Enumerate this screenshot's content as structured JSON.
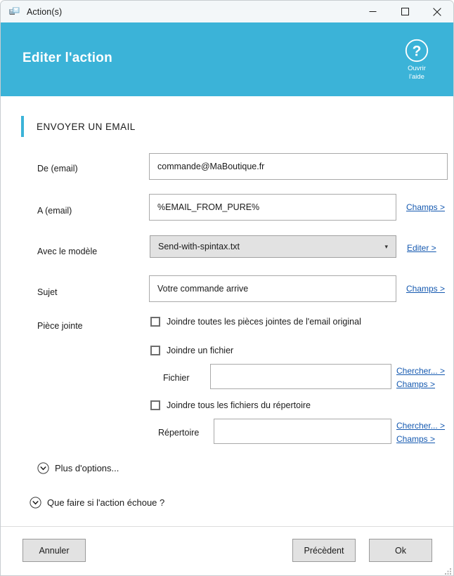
{
  "window": {
    "title": "Action(s)",
    "icon": "mail-action-icon",
    "controls": {
      "minimize": "minimize-icon",
      "maximize": "maximize-icon",
      "close": "close-icon"
    }
  },
  "header": {
    "title": "Editer l'action",
    "accent_color": "#3bb3d8",
    "help": {
      "icon": "question-mark-circle-icon",
      "line1": "Ouvrir",
      "line2": "l'aide"
    }
  },
  "section": {
    "title": "ENVOYER UN EMAIL"
  },
  "fields": {
    "from": {
      "label": "De (email)",
      "value": "commande@MaBoutique.fr",
      "placeholder": ""
    },
    "to": {
      "label": "A (email)",
      "value": "%EMAIL_FROM_PURE%",
      "placeholder": "",
      "link": "Champs >"
    },
    "template": {
      "label": "Avec le modèle",
      "value": "Send-with-spintax.txt",
      "caret": "chevron-down-icon",
      "link": "Editer >"
    },
    "subject": {
      "label": "Sujet",
      "value": "Votre commande arrive",
      "placeholder": "",
      "link": "Champs >"
    }
  },
  "attachment": {
    "label": "Pièce jointe",
    "check_all_original": {
      "label": "Joindre toutes les pièces jointes de l'email original",
      "checked": false
    },
    "check_file": {
      "label": "Joindre un fichier",
      "checked": false
    },
    "file": {
      "label": "Fichier",
      "value": "",
      "placeholder": "",
      "link_browse": "Chercher... >",
      "link_fields": "Champs >"
    },
    "check_directory": {
      "label": "Joindre tous les fichiers du répertoire",
      "checked": false
    },
    "directory": {
      "label": "Répertoire",
      "value": "",
      "placeholder": "",
      "link_browse": "Chercher... >",
      "link_fields": "Champs >"
    }
  },
  "expanders": {
    "more_options": {
      "label": "Plus d'options...",
      "icon": "chevron-down-circle-icon"
    },
    "on_failure": {
      "label": "Que faire si l'action échoue ?",
      "icon": "chevron-down-circle-icon"
    }
  },
  "footer": {
    "cancel": "Annuler",
    "previous": "Précèdent",
    "ok": "Ok"
  }
}
